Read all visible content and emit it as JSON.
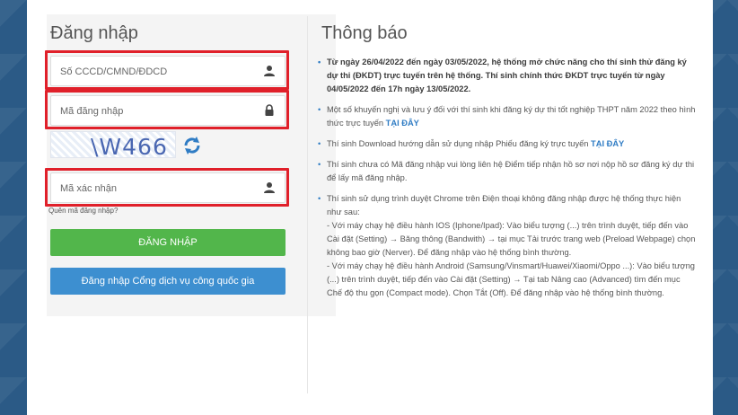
{
  "login": {
    "title": "Đăng nhập",
    "id_placeholder": "Số CCCD/CMND/ĐDCD",
    "password_placeholder": "Mã đăng nhập",
    "captcha_text": "\\W466",
    "captcha_placeholder": "Mã xác nhận",
    "forgot_link": "Quên mã đăng nhập?",
    "login_button": "ĐĂNG NHẬP",
    "gov_button": "Đăng nhập Cổng dịch vụ công quốc gia"
  },
  "notices": {
    "title": "Thông báo",
    "items": [
      {
        "text": "Từ ngày 26/04/2022 đến ngày 03/05/2022, hệ thống mở chức năng cho thí sinh thử đăng ký dự thi (ĐKDT) trực tuyến trên hệ thống. Thí sinh chính thức ĐKDT trực tuyến từ ngày 04/05/2022 đến 17h ngày 13/05/2022."
      },
      {
        "text": "Một số khuyến nghị và lưu ý đối với thí sinh khi đăng ký dự thi tốt nghiệp THPT năm 2022 theo hình thức trực tuyến ",
        "link": "TẠI ĐÂY"
      },
      {
        "text": "Thí sinh Download hướng dẫn sử dụng nhập Phiếu đăng ký trực tuyến ",
        "link": "TẠI ĐÂY"
      },
      {
        "text": "Thí sinh chưa có Mã đăng nhập vui lòng liên hệ Điểm tiếp nhận hồ sơ nơi nộp hồ sơ đăng ký dự thi để lấy mã đăng nhập."
      },
      {
        "text": "Thí sinh sử dụng trình duyệt Chrome trên Điện thoại không đăng nhập được hệ thống thực hiện như sau:",
        "sub1": " - Với máy chạy hệ điều hành IOS (Iphone/Ipad): Vào biểu tượng (...) trên trình duyệt, tiếp đến vào Cài đặt (Setting) → Băng thông (Bandwith) → tại mục Tải trước trang web (Preload Webpage) chọn không bao giờ (Nerver). Để đăng nhập vào hệ thống bình thường.",
        "sub2": " - Với máy chạy hệ điều hành Android (Samsung/Vinsmart/Huawei/Xiaomi/Oppo ...): Vào biểu tượng (...) trên trình duyệt, tiếp đến vào Cài đặt (Setting) → Tại tab Nâng cao (Advanced) tìm đến mục Chế độ thu gọn (Compact mode). Chọn Tắt (Off). Để đăng nhập vào hệ thống bình thường."
      }
    ]
  },
  "colors": {
    "highlight": "#e0202a",
    "login_button": "#52b64b",
    "gov_button": "#3d8fd0",
    "link": "#2f7cc4"
  },
  "icons": [
    "user-icon",
    "lock-icon",
    "refresh-icon"
  ]
}
